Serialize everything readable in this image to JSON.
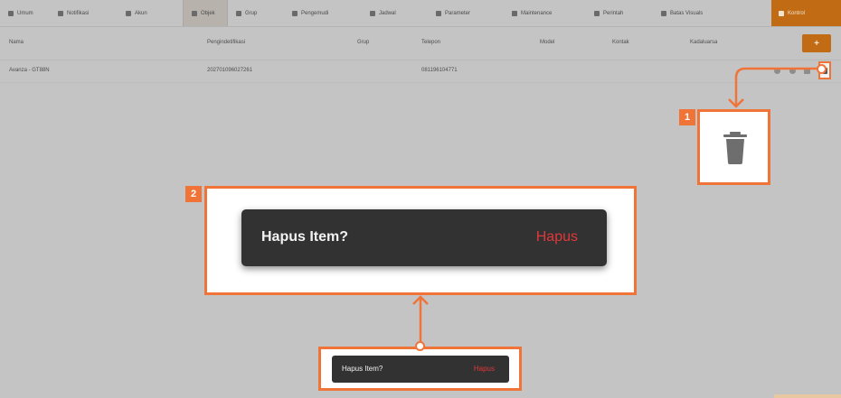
{
  "tabs": [
    {
      "label": "Umum",
      "icon": "gear-icon"
    },
    {
      "label": "Notifikasi",
      "icon": "bell-icon"
    },
    {
      "label": "Akun",
      "icon": "user-icon"
    },
    {
      "label": "Objek",
      "icon": "object-icon"
    },
    {
      "label": "Grup",
      "icon": "folder-icon"
    },
    {
      "label": "Pengemudi",
      "icon": "driver-icon"
    },
    {
      "label": "Jadwal",
      "icon": "calendar-icon"
    },
    {
      "label": "Parameter",
      "icon": "list-icon"
    },
    {
      "label": "Maintenance",
      "icon": "wrench-icon"
    },
    {
      "label": "Perintah",
      "icon": "command-icon"
    },
    {
      "label": "Batas Visuals",
      "icon": "pencil-icon"
    },
    {
      "label": "Kontrol",
      "icon": "plus-icon"
    }
  ],
  "active_tab": "Objek",
  "table": {
    "headers": [
      "Nama",
      "Pengindetifikasi",
      "Grup",
      "Telepon",
      "Model",
      "Kontak",
      "Kadaluarsa"
    ],
    "rows": [
      {
        "name": "Avanza - GT88N",
        "identifier": "202701096027261",
        "group": "",
        "phone": "081196104771"
      }
    ],
    "add_button": "+"
  },
  "callouts": {
    "badge1": "1",
    "badge2": "2"
  },
  "dialog": {
    "title": "Hapus Item?",
    "action": "Hapus"
  },
  "colors": {
    "accent": "#f07438",
    "brand_orange": "#c16c14",
    "dialog_bg": "#323232",
    "danger": "#e0383a"
  }
}
